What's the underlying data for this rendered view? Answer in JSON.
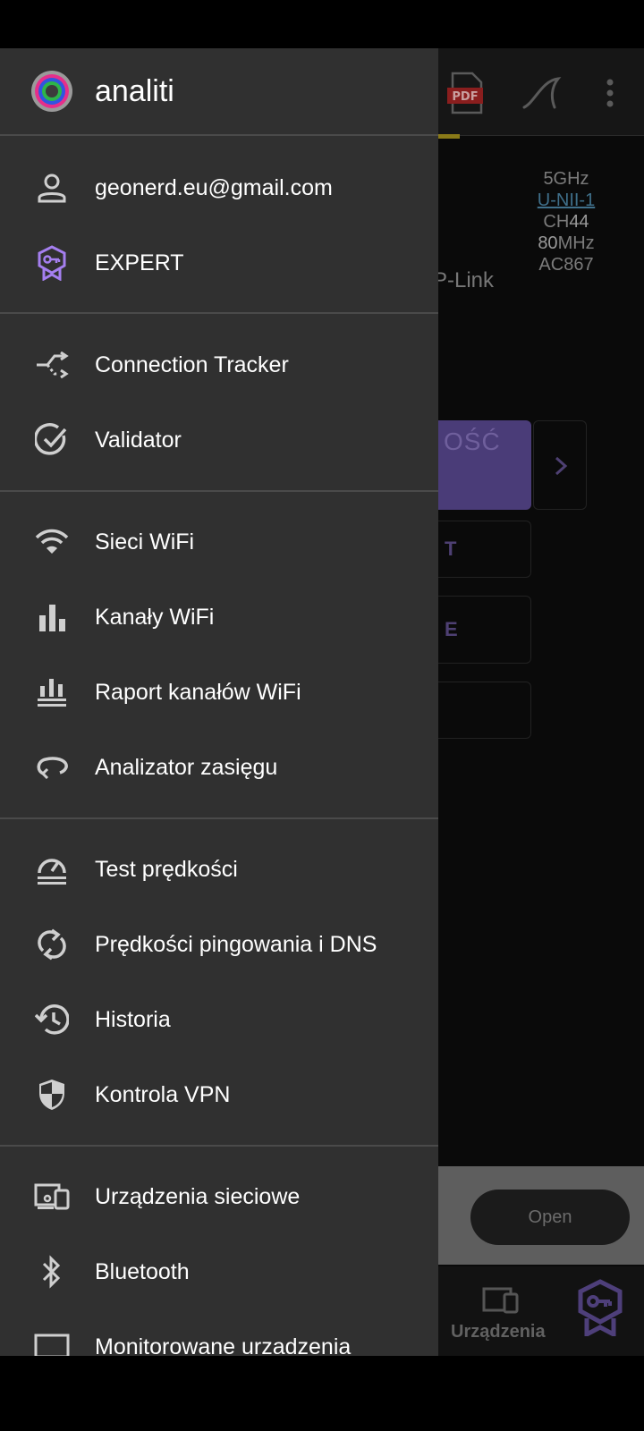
{
  "drawer": {
    "app_name": "analiti",
    "sections": [
      {
        "items": [
          {
            "icon": "person-icon",
            "label": "geonerd.eu@gmail.com"
          },
          {
            "icon": "expert-badge-icon",
            "label": "EXPERT"
          }
        ]
      },
      {
        "items": [
          {
            "icon": "connection-tracker-icon",
            "label": "Connection Tracker"
          },
          {
            "icon": "validator-check-icon",
            "label": "Validator"
          }
        ]
      },
      {
        "items": [
          {
            "icon": "wifi-icon",
            "label": "Sieci WiFi"
          },
          {
            "icon": "bar-chart-icon",
            "label": "Kanały WiFi"
          },
          {
            "icon": "channel-report-icon",
            "label": "Raport kanałów WiFi"
          },
          {
            "icon": "range-analyzer-icon",
            "label": "Analizator zasięgu"
          }
        ]
      },
      {
        "items": [
          {
            "icon": "speedometer-icon",
            "label": "Test prędkości"
          },
          {
            "icon": "sync-icon",
            "label": "Prędkości pingowania i DNS"
          },
          {
            "icon": "history-icon",
            "label": "Historia"
          },
          {
            "icon": "shield-icon",
            "label": "Kontrola VPN"
          }
        ]
      },
      {
        "items": [
          {
            "icon": "network-devices-icon",
            "label": "Urządzenia sieciowe"
          },
          {
            "icon": "bluetooth-icon",
            "label": "Bluetooth"
          },
          {
            "icon": "monitor-icon",
            "label": "Monitorowane urzadzenia"
          }
        ]
      }
    ]
  },
  "background": {
    "pdf_label": "PDF",
    "net_info": {
      "band": "5GHz",
      "unii": "U-NII-1",
      "channel_prefix": "CH",
      "channel": "44",
      "width_value": "80",
      "width_unit": "MHz",
      "standard": "AC867"
    },
    "ssid_partial": "P-Link",
    "purple_button_partial": "OŚĆ",
    "purple_button_sub_partial": "]",
    "button_t_partial": "T",
    "button_e_partial": "E",
    "ad_open_label": "Open",
    "nav_devices_label": "Urządzenia"
  },
  "colors": {
    "drawer_bg": "#303030",
    "divider": "#4a4a4a",
    "accent_purple": "#9b7bea"
  }
}
